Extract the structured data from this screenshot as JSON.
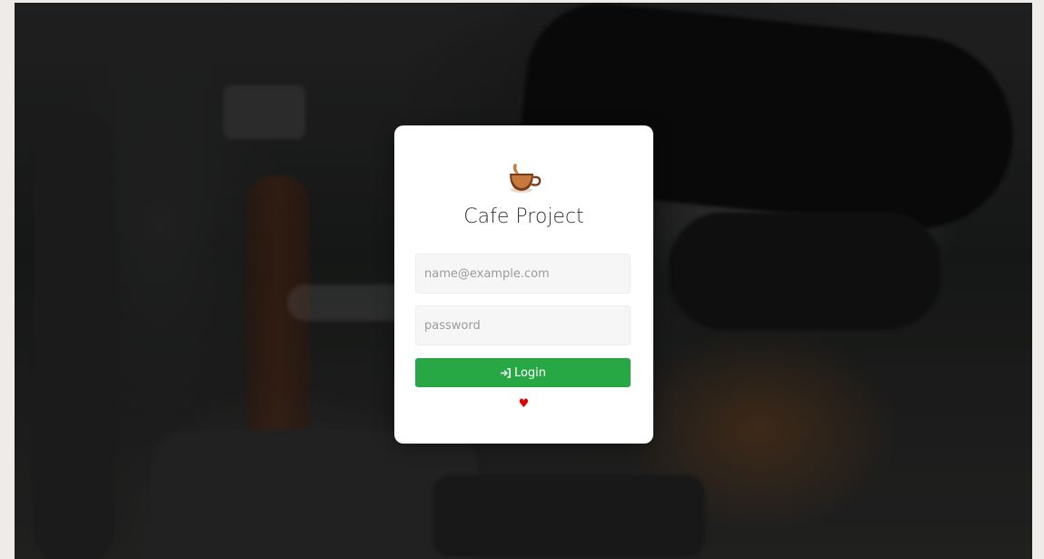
{
  "app": {
    "title": "Cafe Project"
  },
  "form": {
    "email": {
      "value": "",
      "placeholder": "name@example.com"
    },
    "password": {
      "value": "",
      "placeholder": "password"
    },
    "login_label": "Login",
    "login_icon": "sign-in-icon"
  },
  "footer": {
    "heart_glyph": "♥",
    "heart_icon": "heart-icon"
  },
  "colors": {
    "accent": "#28a745",
    "heart": "#e00000",
    "card_bg": "#ffffff"
  }
}
